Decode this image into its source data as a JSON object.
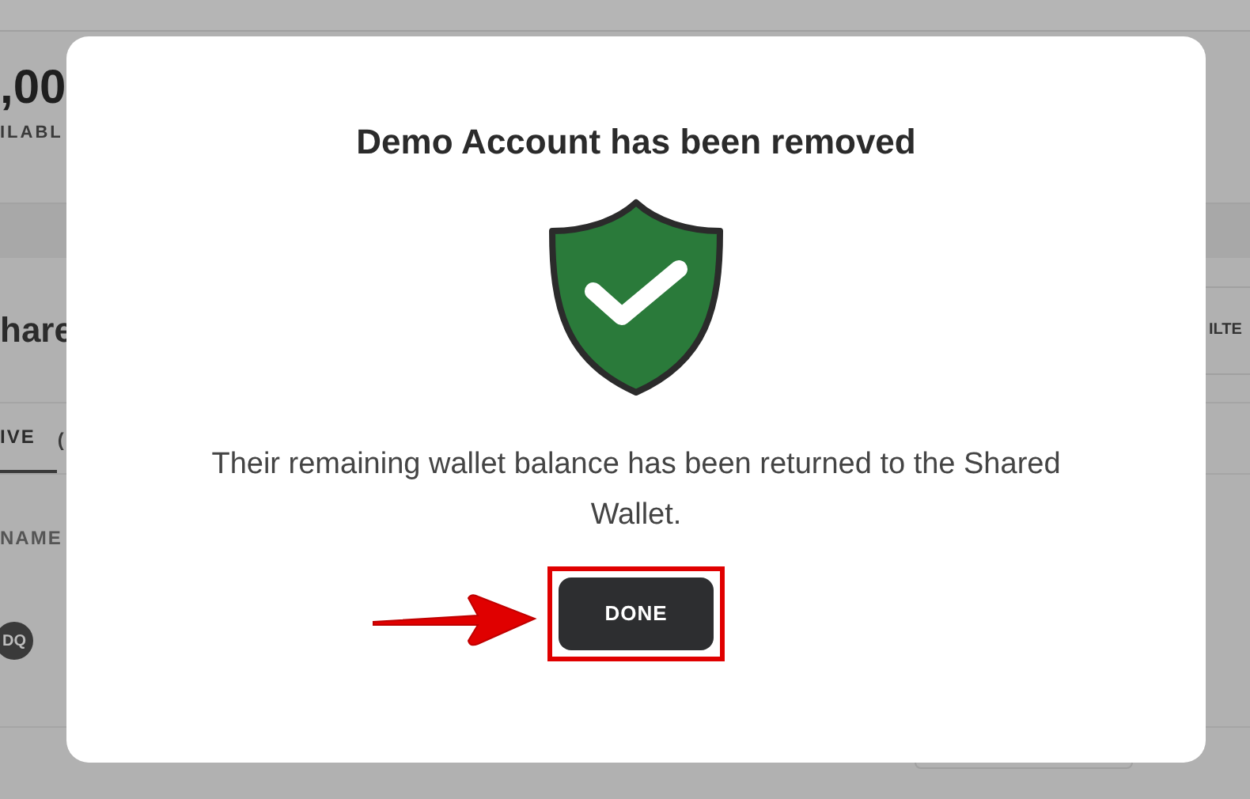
{
  "background": {
    "balance_amount": ",00",
    "balance_label": "ILABL",
    "section_title": "hare",
    "filter_button": "ILTE",
    "tabs": [
      {
        "label": "IVE",
        "selected": true
      },
      {
        "label": "(",
        "selected": false
      }
    ],
    "column_header": "NAME",
    "avatar_initials": "DQ"
  },
  "dialog": {
    "title": "Demo Account has been removed",
    "message": "Their remaining wallet balance has been returned to the Shared Wallet.",
    "button": "DONE",
    "button_highlighted": true
  }
}
